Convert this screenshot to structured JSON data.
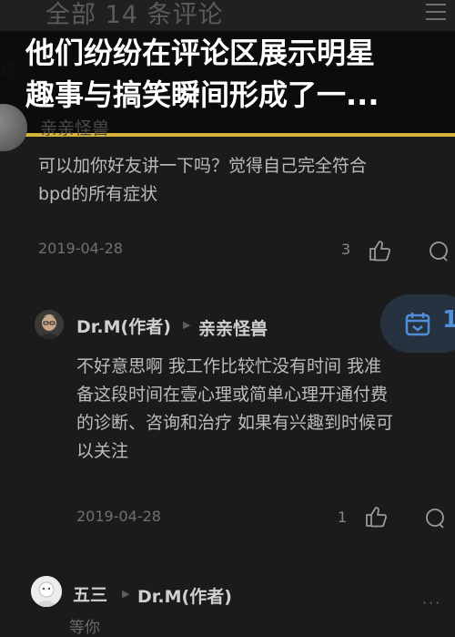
{
  "topbar": {
    "title": "全部 14 条评论",
    "menu_icon": "menu-icon"
  },
  "overlay": {
    "line1": "他们纷纷在评论区展示明星",
    "line2": "趣事与搞笑瞬间形成了一...",
    "accent": "#d6b43a"
  },
  "background_fragment": "论",
  "comment1": {
    "author": "亲亲怪兽",
    "text_line1": "可以加你好友讲一下吗？觉得自己完全符合",
    "text_line2": "bpd的所有症状",
    "date": "2019-04-28",
    "likes": "3"
  },
  "comment2": {
    "author": "Dr.M(作者)",
    "reply_to": "亲亲怪兽",
    "text_lines": [
      "不好意思啊 我工作比较忙没有时间 我准",
      "备这段时间在壹心理或简单心理开通付费",
      "的诊断、咨询和治疗 如果有兴趣到时候可",
      "以关注"
    ],
    "date": "2019-04-28",
    "likes": "1"
  },
  "comment3": {
    "author": "五三",
    "reply_to": "Dr.M(作者)",
    "text_partial": "等你"
  },
  "fab": {
    "count": "1",
    "icon": "calendar-icon",
    "color": "#4f8ed8"
  }
}
